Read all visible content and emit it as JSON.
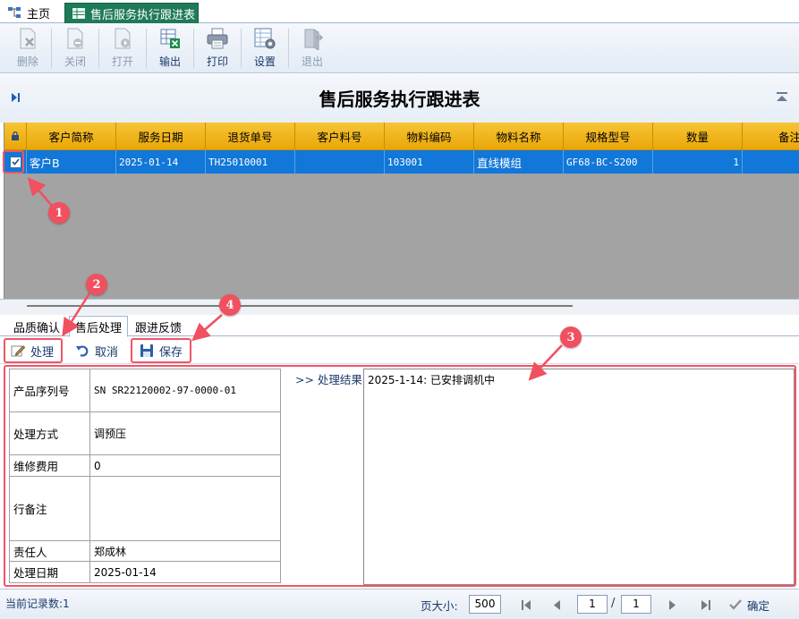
{
  "tabs": {
    "home": "主页",
    "active": "售后服务执行跟进表"
  },
  "toolbar": [
    {
      "label": "删除",
      "icon": "delete-icon",
      "enabled": false
    },
    {
      "label": "关闭",
      "icon": "close-doc-icon",
      "enabled": false
    },
    {
      "label": "打开",
      "icon": "open-doc-icon",
      "enabled": false
    },
    {
      "label": "输出",
      "icon": "export-excel-icon",
      "enabled": true
    },
    {
      "label": "打印",
      "icon": "printer-icon",
      "enabled": true
    },
    {
      "label": "设置",
      "icon": "settings-icon",
      "enabled": true
    },
    {
      "label": "退出",
      "icon": "exit-icon",
      "enabled": false
    }
  ],
  "page_title": "售后服务执行跟进表",
  "grid": {
    "lock_icon": "lock-icon",
    "columns": [
      "客户简称",
      "服务日期",
      "退货单号",
      "客户料号",
      "物料编码",
      "物料名称",
      "规格型号",
      "数量",
      "备注"
    ],
    "rows": [
      {
        "checked": true,
        "cells": [
          "客户B",
          "2025-01-14",
          "TH25010001",
          "",
          "103001",
          "直线模组",
          "GF68-BC-S200",
          "1",
          ""
        ]
      }
    ]
  },
  "subtabs": [
    "品质确认",
    "售后处理",
    "跟进反馈"
  ],
  "active_subtab": "售后处理",
  "actions": {
    "process": "处理",
    "cancel": "取消",
    "save": "保存"
  },
  "form": {
    "fields": [
      {
        "label": "产品序列号",
        "value": "SN SR22120002-97-0000-01"
      },
      {
        "label": "处理方式",
        "value": "调预压"
      },
      {
        "label": "维修费用",
        "value": "0"
      },
      {
        "label": "行备注",
        "value": ""
      },
      {
        "label": "责任人",
        "value": "郑成林"
      },
      {
        "label": "处理日期",
        "value": "2025-01-14"
      }
    ],
    "result_label": ">> 处理结果",
    "result_text": "2025-1-14: 已安排调机中"
  },
  "status": {
    "record_count": "当前记录数:1",
    "page_size_label": "页大小:",
    "page_size": "500",
    "current_page": "1",
    "page_separator": "/",
    "total_pages": "1",
    "confirm": "确定"
  },
  "annotations": [
    "1",
    "2",
    "3",
    "4"
  ],
  "colors": {
    "accent_tab": "#1f7a57",
    "grid_header": "#f0b620",
    "selected_row": "#1177d8",
    "annotation": "#f0505f"
  }
}
